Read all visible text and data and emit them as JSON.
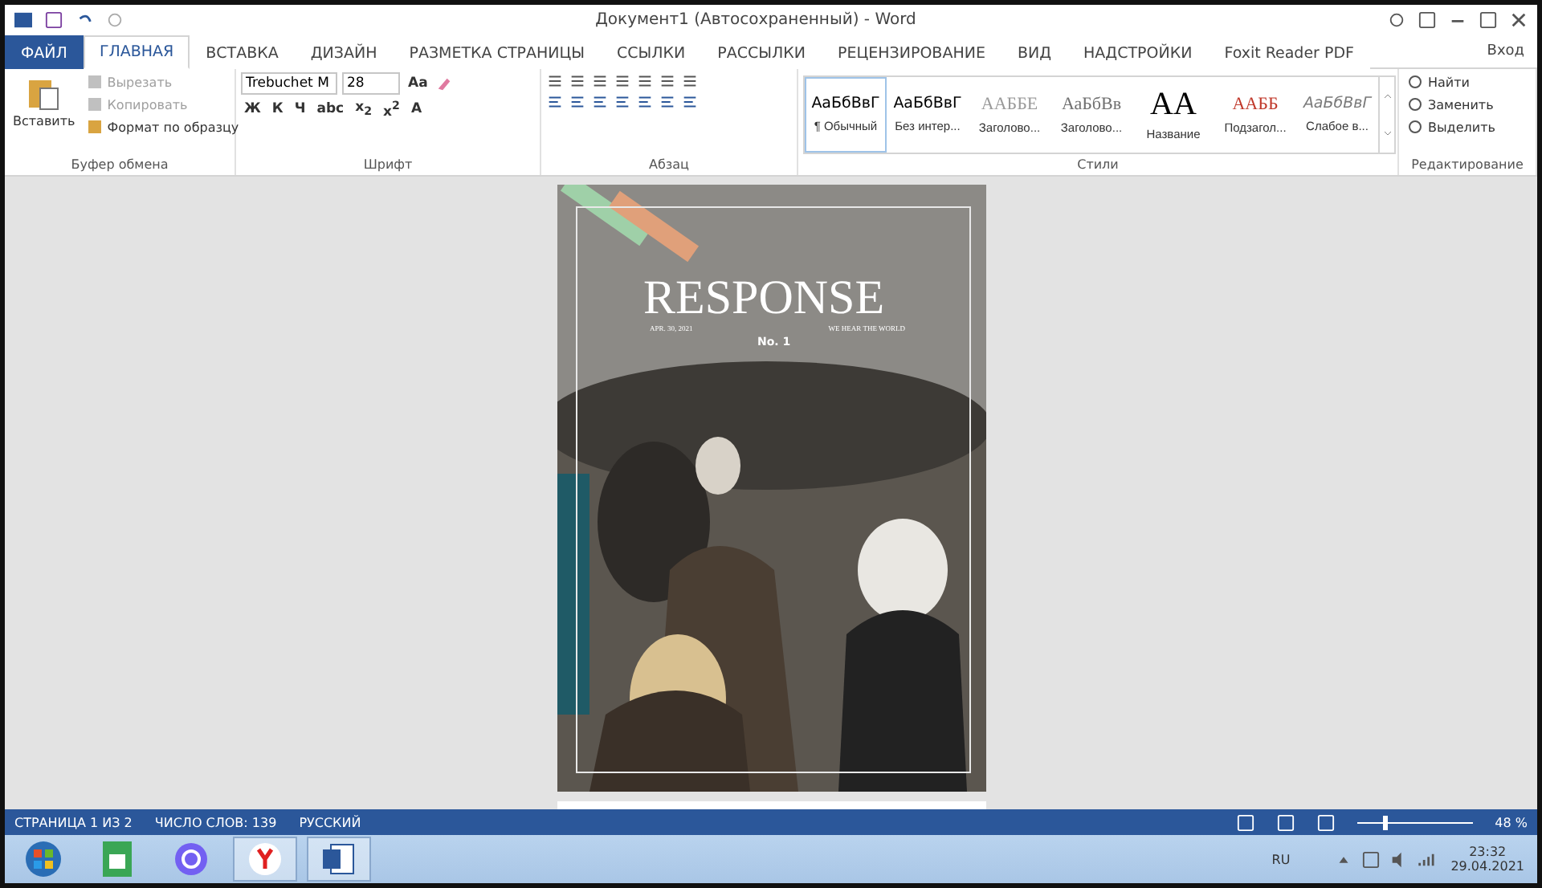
{
  "window": {
    "title": "Документ1 (Автосохраненный) - Word",
    "sign_in": "Вход"
  },
  "tabs": [
    {
      "label": "ФАЙЛ",
      "kind": "file",
      "selected": false
    },
    {
      "label": "ГЛАВНАЯ",
      "kind": "tab",
      "selected": true
    },
    {
      "label": "ВСТАВКА",
      "kind": "tab",
      "selected": false
    },
    {
      "label": "ДИЗАЙН",
      "kind": "tab",
      "selected": false
    },
    {
      "label": "РАЗМЕТКА СТРАНИЦЫ",
      "kind": "tab",
      "selected": false
    },
    {
      "label": "ССЫЛКИ",
      "kind": "tab",
      "selected": false
    },
    {
      "label": "РАССЫЛКИ",
      "kind": "tab",
      "selected": false
    },
    {
      "label": "РЕЦЕНЗИРОВАНИЕ",
      "kind": "tab",
      "selected": false
    },
    {
      "label": "ВИД",
      "kind": "tab",
      "selected": false
    },
    {
      "label": "НАДСТРОЙКИ",
      "kind": "tab",
      "selected": false
    },
    {
      "label": "Foxit Reader PDF",
      "kind": "tab",
      "selected": false
    }
  ],
  "clipboard": {
    "label": "Буфер обмена",
    "paste": "Вставить",
    "items": [
      {
        "label": "Вырезать",
        "disabled": true
      },
      {
        "label": "Копировать",
        "disabled": true
      },
      {
        "label": "Формат по образцу",
        "disabled": false
      }
    ]
  },
  "font": {
    "label": "Шрифт",
    "name": "Trebuchet M",
    "size": "28",
    "case_button": "Aa",
    "format_buttons": [
      "Ж",
      "К",
      "Ч",
      "abc",
      "x$_{2}$",
      "x$^{2}$"
    ],
    "color_button": "A"
  },
  "paragraph": {
    "label": "Абзац"
  },
  "styles": {
    "label": "Стили",
    "items": [
      {
        "preview": "АаБбВвГ",
        "name": "¶ Обычный",
        "selected": true,
        "kind": "normal",
        "color": "#000000"
      },
      {
        "preview": "АаБбВвГ",
        "name": "Без интер...",
        "selected": false,
        "kind": "normal",
        "color": "#000000"
      },
      {
        "preview": "ААББЕ",
        "name": "Заголово...",
        "selected": false,
        "kind": "serif",
        "color": "#9a9a9a"
      },
      {
        "preview": "АаБбВв",
        "name": "Заголово...",
        "selected": false,
        "kind": "serif",
        "color": "#707070"
      },
      {
        "preview": "АА",
        "name": "Название",
        "selected": false,
        "kind": "title",
        "color": "#000000"
      },
      {
        "preview": "ААББ",
        "name": "Подзагол...",
        "selected": false,
        "kind": "serif",
        "color": "#c0392b"
      },
      {
        "preview": "АаБбВвГ",
        "name": "Слабое в...",
        "selected": false,
        "kind": "italic",
        "color": "#7a7a7a"
      }
    ]
  },
  "editing": {
    "label": "Редактирование",
    "items": [
      "Найти",
      "Заменить",
      "Выделить"
    ]
  },
  "document": {
    "cover": {
      "title": "RESPONSE",
      "date": "APR. 30, 2021",
      "tagline": "WE HEAR THE WORLD",
      "issue": "No. 1"
    }
  },
  "status_bar": {
    "items": [
      "СТРАНИЦА 1 ИЗ 2",
      "ЧИСЛО СЛОВ: 139",
      "РУССКИЙ"
    ],
    "zoom": {
      "level": 0.22,
      "reading": "48 %"
    }
  },
  "taskbar": {
    "language": "RU",
    "time": "23:32",
    "date": "29.04.2021"
  }
}
